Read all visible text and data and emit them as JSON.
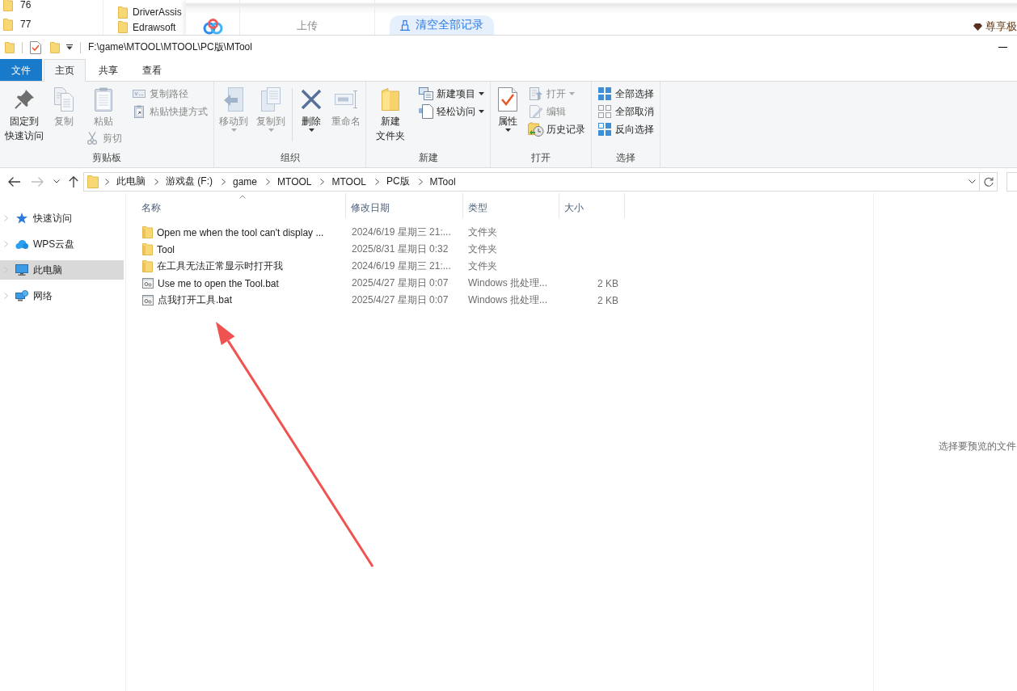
{
  "background_windows": {
    "folder_list": [
      {
        "label": "76"
      },
      {
        "label": "77"
      }
    ],
    "folder_list_2": [
      {
        "label": "DriverAssis"
      },
      {
        "label": "Edrawsoft"
      }
    ],
    "app_panel": {
      "tab": "上传",
      "clear_button": "清空全部记录",
      "vip_label": "尊享极"
    }
  },
  "window": {
    "title": "F:\\game\\MTOOL\\MTOOL\\PC版\\MTool"
  },
  "tabs": [
    {
      "label": "文件",
      "kind": "file",
      "selected": false
    },
    {
      "label": "主页",
      "kind": "tab",
      "selected": true
    },
    {
      "label": "共享",
      "kind": "tab",
      "selected": false
    },
    {
      "label": "查看",
      "kind": "tab",
      "selected": false
    }
  ],
  "ribbon": {
    "groups": [
      {
        "label": "剪贴板",
        "columns": [
          {
            "commands": [
              {
                "label": "固定到快速访问",
                "kind": "large",
                "disabled": false,
                "dropdown": false
              }
            ]
          },
          {
            "commands": [
              {
                "label": "复制",
                "kind": "large",
                "disabled": true,
                "dropdown": false
              }
            ]
          },
          {
            "commands": [
              {
                "label": "粘贴",
                "kind": "large",
                "disabled": true,
                "dropdown": false
              },
              {
                "label": "剪切",
                "kind": "small",
                "disabled": true,
                "dropdown": false
              }
            ]
          },
          {
            "commands": [
              {
                "label": "复制路径",
                "kind": "small",
                "disabled": true,
                "dropdown": false
              },
              {
                "label": "粘贴快捷方式",
                "kind": "small",
                "disabled": true,
                "dropdown": false
              }
            ]
          }
        ]
      },
      {
        "label": "组织",
        "columns": [
          {
            "commands": [
              {
                "label": "移动到",
                "kind": "large",
                "disabled": true,
                "dropdown": true
              }
            ]
          },
          {
            "commands": [
              {
                "label": "复制到",
                "kind": "large",
                "disabled": true,
                "dropdown": true
              }
            ]
          },
          {
            "separator": true,
            "commands": [
              {
                "label": "删除",
                "kind": "large",
                "disabled": false,
                "dropdown": true
              }
            ]
          },
          {
            "commands": [
              {
                "label": "重命名",
                "kind": "large",
                "disabled": true,
                "dropdown": false
              }
            ]
          }
        ]
      },
      {
        "label": "新建",
        "columns": [
          {
            "commands": [
              {
                "label": "新建文件夹",
                "kind": "large",
                "disabled": false,
                "dropdown": false
              }
            ]
          },
          {
            "commands": [
              {
                "label": "新建项目",
                "kind": "small",
                "disabled": false,
                "dropdown": true
              },
              {
                "label": "轻松访问",
                "kind": "small",
                "disabled": false,
                "dropdown": true
              }
            ]
          }
        ]
      },
      {
        "label": "打开",
        "columns": [
          {
            "commands": [
              {
                "label": "属性",
                "kind": "large",
                "disabled": false,
                "dropdown": true
              }
            ]
          },
          {
            "commands": [
              {
                "label": "打开",
                "kind": "small",
                "disabled": true,
                "dropdown": true
              },
              {
                "label": "编辑",
                "kind": "small",
                "disabled": true,
                "dropdown": false
              },
              {
                "label": "历史记录",
                "kind": "small",
                "disabled": false,
                "dropdown": false
              }
            ]
          }
        ]
      },
      {
        "label": "选择",
        "columns": [
          {
            "commands": [
              {
                "label": "全部选择",
                "kind": "small",
                "disabled": false,
                "dropdown": false
              },
              {
                "label": "全部取消",
                "kind": "small",
                "disabled": false,
                "dropdown": false
              },
              {
                "label": "反向选择",
                "kind": "small",
                "disabled": false,
                "dropdown": false
              }
            ]
          }
        ]
      }
    ]
  },
  "navigation": [
    {
      "kind": "back",
      "disabled": false
    },
    {
      "kind": "forward",
      "disabled": true
    },
    {
      "kind": "recent",
      "disabled": false
    },
    {
      "kind": "up",
      "disabled": false
    }
  ],
  "address_bar": {
    "path": [
      "此电脑",
      "游戏盘 (F:)",
      "game",
      "MTOOL",
      "MTOOL",
      "PC版",
      "MTool"
    ]
  },
  "sidebar": {
    "items": [
      {
        "label": "快速访问",
        "selected": false
      },
      {
        "label": "WPS云盘",
        "selected": false
      },
      {
        "label": "此电脑",
        "selected": true
      },
      {
        "label": "网络",
        "selected": false
      }
    ]
  },
  "file_list": {
    "columns": [
      {
        "label": "名称",
        "sorted": true
      },
      {
        "label": "修改日期",
        "sorted": false
      },
      {
        "label": "类型",
        "sorted": false
      },
      {
        "label": "大小",
        "sorted": false
      }
    ],
    "rows": [
      {
        "kind": "folder",
        "name": "Open me when the tool can't display ...",
        "modified": "2024/6/19 星期三 21:...",
        "type": "文件夹"
      },
      {
        "kind": "folder",
        "name": "Tool",
        "modified": "2025/8/31 星期日 0:32",
        "type": "文件夹"
      },
      {
        "kind": "folder",
        "name": "在工具无法正常显示时打开我",
        "modified": "2024/6/19 星期三 21:...",
        "type": "文件夹"
      },
      {
        "kind": "batch",
        "name": "Use me to open the Tool.bat",
        "modified": "2025/4/27 星期日 0:07",
        "type": "Windows 批处理...",
        "size": "2 KB"
      },
      {
        "kind": "batch",
        "name": "点我打开工具.bat",
        "modified": "2025/4/27 星期日 0:07",
        "type": "Windows 批处理...",
        "size": "2 KB"
      }
    ]
  },
  "preview_pane": {
    "message": "选择要预览的文件"
  }
}
